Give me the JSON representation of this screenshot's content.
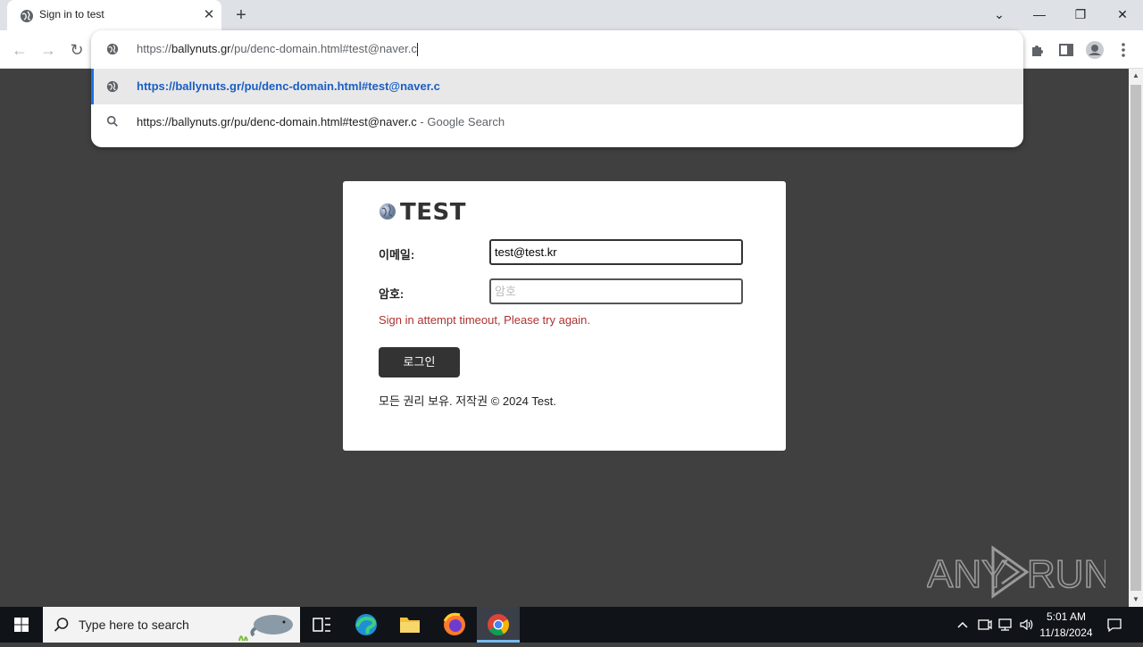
{
  "browser": {
    "tab_title": "Sign in to test",
    "tab_close": "✕",
    "new_tab": "+",
    "window": {
      "dropdown": "⌄",
      "minimize": "—",
      "restore": "❐",
      "close": "✕"
    },
    "nav": {
      "back": "←",
      "forward": "→",
      "reload": "↻"
    }
  },
  "omnibox": {
    "input_prefix": "https://",
    "input_host": "ballynuts.gr",
    "input_path": "/pu/denc-domain.html#test@naver.c",
    "suggestion_url": "https://ballynuts.gr/pu/denc-domain.html#test@naver.c",
    "suggestion_search": "https://ballynuts.gr/pu/denc-domain.html#test@naver.c",
    "suggestion_search_suffix": " - Google Search"
  },
  "card": {
    "logo_text": "TEST",
    "email_label": "이메일:",
    "email_value": "test@test.kr",
    "password_label": "암호:",
    "password_placeholder": "암호",
    "error": "Sign in attempt timeout, Please try again.",
    "login_button": "로그인",
    "footer": "모든 권리 보유. 저작권 © 2024 Test."
  },
  "watermark": {
    "text_left": "ANY",
    "text_right": "RUN"
  },
  "taskbar": {
    "search_placeholder": "Type here to search",
    "time": "5:01 AM",
    "date": "11/18/2024"
  },
  "colors": {
    "accent": "#1a73e8",
    "error": "#b03030",
    "page_bg": "#404040",
    "button_bg": "#333333"
  }
}
